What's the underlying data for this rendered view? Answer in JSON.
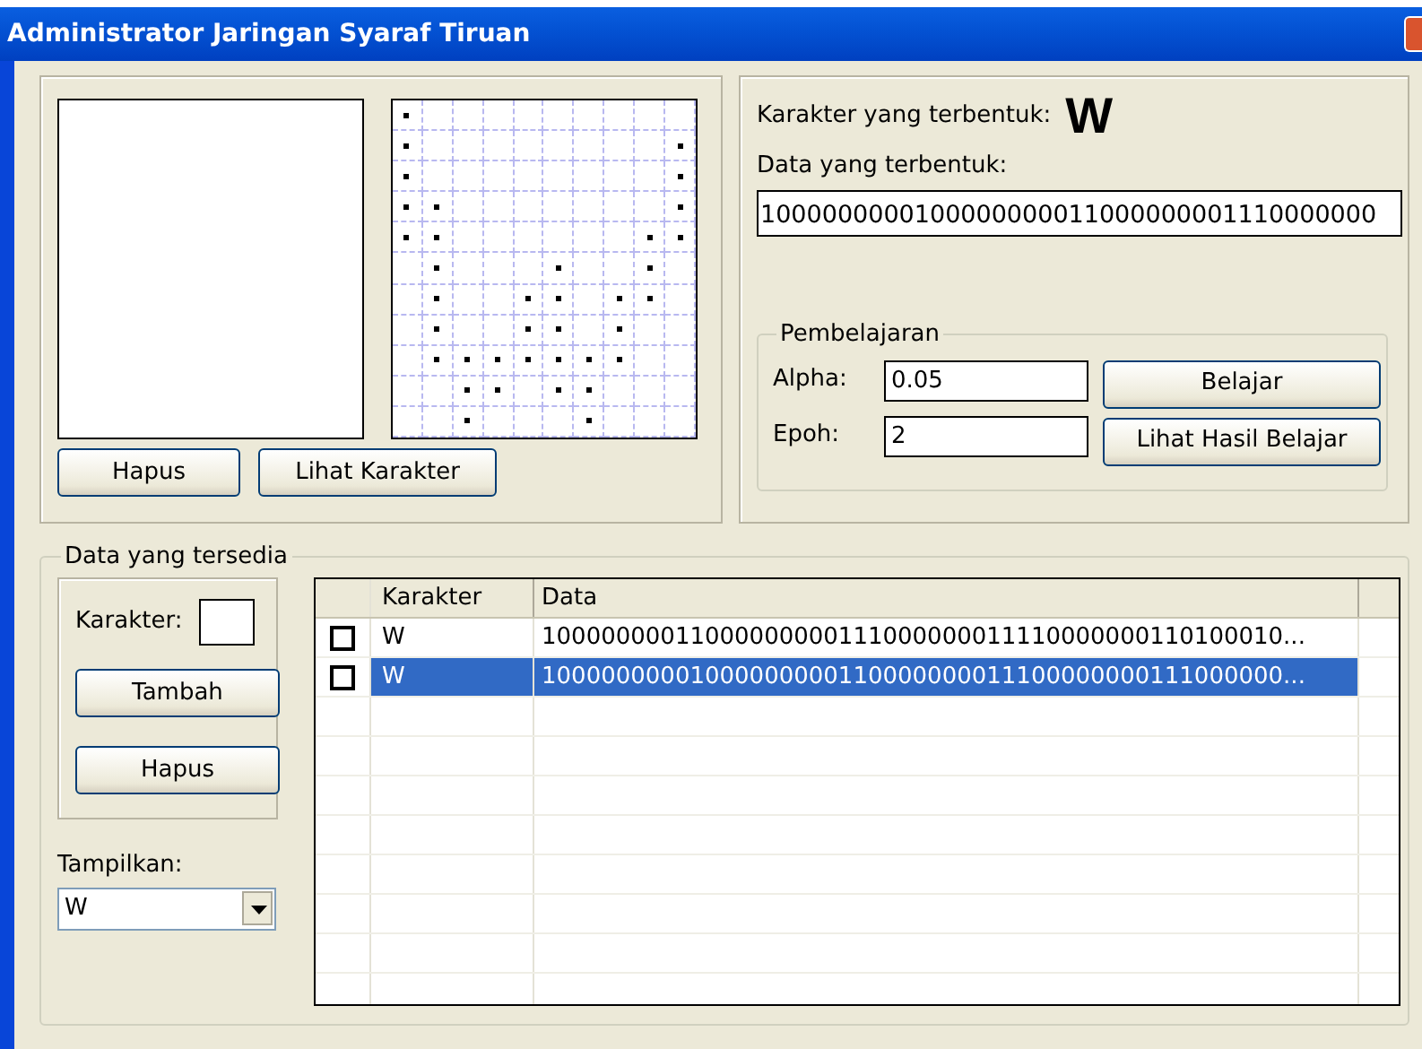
{
  "window": {
    "title": "Administrator Jaringan Syaraf Tiruan"
  },
  "drawing_panel": {
    "buttons": [
      "Hapus",
      "Lihat Karakter"
    ]
  },
  "grid": {
    "rows": [
      [
        true,
        false,
        false,
        false,
        false,
        false,
        false,
        false,
        false,
        false
      ],
      [
        true,
        false,
        false,
        false,
        false,
        false,
        false,
        false,
        false,
        true
      ],
      [
        true,
        false,
        false,
        false,
        false,
        false,
        false,
        false,
        false,
        true
      ],
      [
        true,
        true,
        false,
        false,
        false,
        false,
        false,
        false,
        false,
        true
      ],
      [
        true,
        true,
        false,
        false,
        false,
        false,
        false,
        false,
        true,
        true
      ],
      [
        false,
        true,
        false,
        false,
        false,
        true,
        false,
        false,
        true,
        false
      ],
      [
        false,
        true,
        false,
        false,
        true,
        true,
        false,
        true,
        true,
        false
      ],
      [
        false,
        true,
        false,
        false,
        true,
        true,
        false,
        true,
        false,
        false
      ],
      [
        false,
        true,
        true,
        true,
        true,
        true,
        true,
        true,
        false,
        false
      ],
      [
        false,
        false,
        true,
        true,
        false,
        true,
        true,
        false,
        false,
        false
      ],
      [
        false,
        false,
        true,
        false,
        false,
        false,
        true,
        false,
        false,
        false
      ]
    ]
  },
  "result": {
    "character_label": "Karakter yang terbentuk:",
    "character": "W",
    "data_label": "Data yang terbentuk:",
    "data_value": "1000000000100000000011000000001110000000"
  },
  "learning": {
    "legend": "Pembelajaran",
    "alpha_label": "Alpha:",
    "alpha": "0.05",
    "epoch_label": "Epoh:",
    "epoch": "2",
    "buttons": [
      "Belajar",
      "Lihat Hasil Belajar"
    ]
  },
  "available": {
    "legend": "Data yang tersedia",
    "character_label": "Karakter:",
    "buttons": [
      "Tambah",
      "Hapus"
    ],
    "show_label": "Tampilkan:",
    "show_value": "W"
  },
  "table": {
    "columns": [
      "Karakter",
      "Data"
    ],
    "rows": [
      {
        "checked": false,
        "selected": false,
        "karakter": "W",
        "data": "10000000011000000000111000000011110000000110100010..."
      },
      {
        "checked": false,
        "selected": true,
        "karakter": "W",
        "data": "10000000001000000000110000000011100000000111000000..."
      }
    ]
  }
}
